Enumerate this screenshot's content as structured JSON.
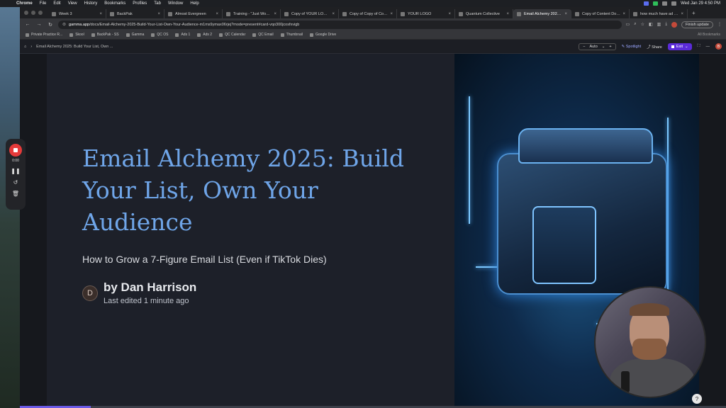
{
  "menubar": {
    "app": "Chrome",
    "items": [
      "File",
      "Edit",
      "View",
      "History",
      "Bookmarks",
      "Profiles",
      "Tab",
      "Window",
      "Help"
    ],
    "clock": "Wed Jan 29  4:50 PM"
  },
  "tabs": [
    {
      "label": "Week 3"
    },
    {
      "label": "BackPak"
    },
    {
      "label": "Almost Evergreen"
    },
    {
      "label": "Training - \"Just Wow\" S"
    },
    {
      "label": "Copy of YOUR LOGO -"
    },
    {
      "label": "Copy of Copy of Copy o"
    },
    {
      "label": "YOUR LOGO"
    },
    {
      "label": "Quantum Collective"
    },
    {
      "label": "Email Alchemy 2025: Bu"
    },
    {
      "label": "Copy of Content Doc fo"
    },
    {
      "label": "how much have ad cos"
    }
  ],
  "active_tab_index": 8,
  "omnibox": {
    "host": "gamma.app",
    "path": "/docs/Email-Alchemy-2025-Build-Your-List-Own-Your-Audience-m1ms9ymax06rjej?mode=present#card-vqo300jcosfxvigb"
  },
  "toolbar": {
    "finish_update": "Finish update"
  },
  "bookmarks": {
    "items": [
      "Private Practice R...",
      "Skool",
      "BackPak - SS",
      "Gamma",
      "QC OS",
      "Ads 1",
      "Ads 2",
      "QC Calendar",
      "QC Email",
      "Thumbnail",
      "Google Drive"
    ],
    "all": "All Bookmarks"
  },
  "appbar": {
    "breadcrumb": "Email Alchemy 2025: Build Your List, Own ...",
    "zoom": "Auto",
    "spotlight": "Spotlight",
    "share": "Share",
    "exit": "Exit",
    "user_initial": "B"
  },
  "slide": {
    "title": "Email Alchemy 2025: Build Your List, Own Your Audience",
    "subtitle": "How to Grow a 7-Figure Email List (Even if TikTok Dies)",
    "author_initial": "D",
    "author": "by Dan Harrison",
    "edited": "Last edited 1 minute ago",
    "progress_fraction": 0.1
  },
  "recorder": {
    "time": "0:00"
  },
  "colors": {
    "title": "#6fa5e8",
    "accent": "#5b2bd9",
    "record": "#e53a3a"
  }
}
